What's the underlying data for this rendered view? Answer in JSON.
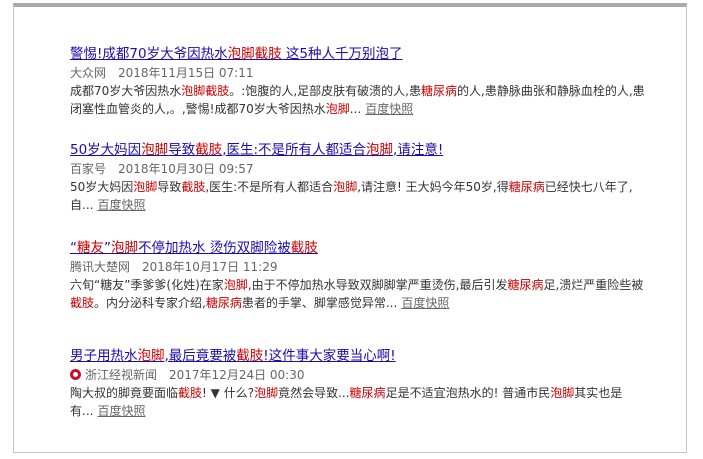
{
  "results": [
    {
      "title": [
        {
          "t": "警惕!成都70岁大爷因热水",
          "em": false
        },
        {
          "t": "泡脚截肢",
          "em": true
        },
        {
          "t": " 这5种人千万别泡了",
          "em": false
        }
      ],
      "source": "大众网",
      "date": "2018年11月15日 07:11",
      "icon": "",
      "snippet": [
        {
          "t": "成都70岁大爷因热水",
          "em": false
        },
        {
          "t": "泡脚截肢",
          "em": true
        },
        {
          "t": "。:饱腹的人,足部皮肤有破溃的人,患",
          "em": false
        },
        {
          "t": "糖尿病",
          "em": true
        },
        {
          "t": "的人,患静脉曲张和静脉血栓的人,患闭塞性血管炎的人,。,警惕!成都70岁大爷因热水",
          "em": false
        },
        {
          "t": "泡脚",
          "em": true
        },
        {
          "t": "...",
          "em": false
        }
      ],
      "snapshot": "百度快照"
    },
    {
      "title": [
        {
          "t": "50岁大妈因",
          "em": false
        },
        {
          "t": "泡脚",
          "em": true
        },
        {
          "t": "导致",
          "em": false
        },
        {
          "t": "截肢",
          "em": true
        },
        {
          "t": ",医生:不是所有人都适合",
          "em": false
        },
        {
          "t": "泡脚",
          "em": true
        },
        {
          "t": ",请注意!",
          "em": false
        }
      ],
      "source": "百家号",
      "date": "2018年10月30日 09:57",
      "icon": "",
      "snippet": [
        {
          "t": "50岁大妈因",
          "em": false
        },
        {
          "t": "泡脚",
          "em": true
        },
        {
          "t": "导致",
          "em": false
        },
        {
          "t": "截肢",
          "em": true
        },
        {
          "t": ",医生:不是所有人都适合",
          "em": false
        },
        {
          "t": "泡脚",
          "em": true
        },
        {
          "t": ",请注意! 王大妈今年50岁,得",
          "em": false
        },
        {
          "t": "糖尿病",
          "em": true
        },
        {
          "t": "已经快七八年了,自...",
          "em": false
        }
      ],
      "snapshot": "百度快照"
    },
    {
      "title": [
        {
          "t": "“",
          "em": false
        },
        {
          "t": "糖友",
          "em": true
        },
        {
          "t": "”",
          "em": false
        },
        {
          "t": "泡脚",
          "em": true
        },
        {
          "t": "不停加热水 烫伤双脚险被",
          "em": false
        },
        {
          "t": "截肢",
          "em": true
        }
      ],
      "source": "腾讯大楚网",
      "date": "2018年10月17日 11:29",
      "icon": "",
      "snippet": [
        {
          "t": "六旬“糖友”季爹爹(化姓)在家",
          "em": false
        },
        {
          "t": "泡脚",
          "em": true
        },
        {
          "t": ",由于不停加热水导致双脚脚掌严重烫伤,最后引发",
          "em": false
        },
        {
          "t": "糖尿病",
          "em": true
        },
        {
          "t": "足,溃烂严重险些被",
          "em": false
        },
        {
          "t": "截肢",
          "em": true
        },
        {
          "t": "。内分泌科专家介绍,",
          "em": false
        },
        {
          "t": "糖尿病",
          "em": true
        },
        {
          "t": "患者的手掌、脚掌感觉异常...",
          "em": false
        }
      ],
      "snapshot": "百度快照"
    },
    {
      "title": [
        {
          "t": "男子用热水",
          "em": false
        },
        {
          "t": "泡脚",
          "em": true
        },
        {
          "t": ",最后竟要被",
          "em": false
        },
        {
          "t": "截肢",
          "em": true
        },
        {
          "t": "!这件事大家要当心啊!",
          "em": false
        }
      ],
      "source": "浙江经视新闻",
      "date": "2017年12月24日 00:30",
      "icon": "news-source-logo-icon",
      "snippet": [
        {
          "t": "陶大叔的脚竟要面临",
          "em": false
        },
        {
          "t": "截肢",
          "em": true
        },
        {
          "t": "! ▼ 什么?",
          "em": false
        },
        {
          "t": "泡脚",
          "em": true
        },
        {
          "t": "竟然会导致...",
          "em": false
        },
        {
          "t": "糖尿病",
          "em": true
        },
        {
          "t": "足是不适宜泡热水的! 普通市民",
          "em": false
        },
        {
          "t": "泡脚",
          "em": true
        },
        {
          "t": "其实也是有...",
          "em": false
        }
      ],
      "snapshot": "百度快照"
    }
  ],
  "colors": {
    "title": "#1a0dab",
    "highlight": "#cc0000",
    "meta": "#666666",
    "text": "#333333"
  }
}
